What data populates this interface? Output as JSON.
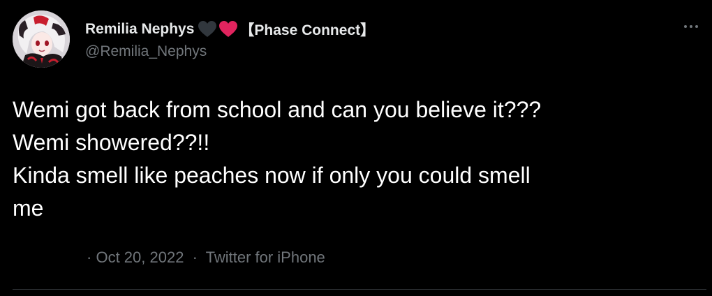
{
  "author": {
    "display_name": "Remilia Nephys",
    "hearts": [
      "black-heart",
      "red-heart"
    ],
    "org": "【Phase Connect】",
    "handle": "@Remilia_Nephys"
  },
  "tweet": {
    "lines": [
      "Wemi got back from school and can you believe it???",
      "Wemi showered??!!",
      "Kinda smell like peaches now if only you could smell",
      "me"
    ]
  },
  "meta": {
    "leading_separator": "·",
    "date": "Oct 20, 2022",
    "separator": "·",
    "source": "Twitter for iPhone"
  },
  "icons": {
    "more": "more-options-icon"
  },
  "colors": {
    "background": "#000000",
    "text_primary": "#ffffff",
    "text_secondary": "#71767b",
    "divider": "#2f3336",
    "heart_red": "#e0245e",
    "heart_black": "#31373d"
  }
}
